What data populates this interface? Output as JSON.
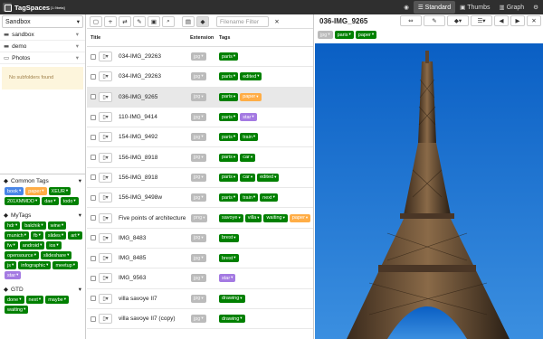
{
  "app": {
    "title": "TagSpaces",
    "version": "[1.9beta]"
  },
  "topbar": {
    "standard": "Standard",
    "thumbs": "Thumbs",
    "graph": "Graph"
  },
  "location": "Sandbox",
  "folders": [
    "sandbox",
    "demo",
    "Photos"
  ],
  "no_subfolders": "No subfolders found",
  "tag_groups": [
    {
      "name": "Common Tags",
      "tags": [
        {
          "label": "book",
          "color": "blue"
        },
        {
          "label": "paper",
          "color": "orange"
        },
        {
          "label": "XEUR",
          "color": "green"
        },
        {
          "label": "201XMMDD",
          "color": "green"
        },
        {
          "label": "dae",
          "color": "green"
        },
        {
          "label": "todo",
          "color": "green"
        }
      ]
    },
    {
      "name": "MyTags",
      "tags": [
        {
          "label": "hdr",
          "color": "green"
        },
        {
          "label": "balchik",
          "color": "green"
        },
        {
          "label": "wine",
          "color": "green"
        },
        {
          "label": "munich",
          "color": "green"
        },
        {
          "label": "fb",
          "color": "green"
        },
        {
          "label": "slides",
          "color": "green"
        },
        {
          "label": "art",
          "color": "green"
        },
        {
          "label": "fw",
          "color": "green"
        },
        {
          "label": "android",
          "color": "green"
        },
        {
          "label": "ios",
          "color": "green"
        },
        {
          "label": "opensource",
          "color": "green"
        },
        {
          "label": "slideshare",
          "color": "green"
        },
        {
          "label": "js",
          "color": "green"
        },
        {
          "label": "infographic",
          "color": "green"
        },
        {
          "label": "meetup",
          "color": "green"
        },
        {
          "label": "star",
          "color": "purple"
        }
      ]
    },
    {
      "name": "GTD",
      "tags": [
        {
          "label": "done",
          "color": "green"
        },
        {
          "label": "next",
          "color": "green"
        },
        {
          "label": "maybe",
          "color": "green"
        },
        {
          "label": "waiting",
          "color": "green"
        }
      ]
    }
  ],
  "filter_placeholder": "Filename Filter",
  "columns": {
    "title": "Title",
    "extension": "Extension",
    "tags": "Tags"
  },
  "files": [
    {
      "name": "034-IMG_29263",
      "ext": "jpg",
      "tags": [
        {
          "label": "paris",
          "color": "green"
        }
      ]
    },
    {
      "name": "034-IMG_29263",
      "ext": "jpg",
      "tags": [
        {
          "label": "paris",
          "color": "green"
        },
        {
          "label": "edited",
          "color": "green"
        }
      ]
    },
    {
      "name": "036-IMG_9265",
      "ext": "jpg",
      "tags": [
        {
          "label": "paris",
          "color": "green"
        },
        {
          "label": "paper",
          "color": "orange"
        }
      ],
      "selected": true
    },
    {
      "name": "110-IMG_9414",
      "ext": "jpg",
      "tags": [
        {
          "label": "paris",
          "color": "green"
        },
        {
          "label": "star",
          "color": "purple"
        }
      ]
    },
    {
      "name": "154-IMG_9492",
      "ext": "jpg",
      "tags": [
        {
          "label": "paris",
          "color": "green"
        },
        {
          "label": "train",
          "color": "green"
        }
      ]
    },
    {
      "name": "156-IMG_8918",
      "ext": "jpg",
      "tags": [
        {
          "label": "paris",
          "color": "green"
        },
        {
          "label": "car",
          "color": "green"
        }
      ]
    },
    {
      "name": "156-IMG_8918",
      "ext": "jpg",
      "tags": [
        {
          "label": "paris",
          "color": "green"
        },
        {
          "label": "car",
          "color": "green"
        },
        {
          "label": "edited",
          "color": "green"
        }
      ]
    },
    {
      "name": "156-IMG_9498w",
      "ext": "jpg",
      "tags": [
        {
          "label": "paris",
          "color": "green"
        },
        {
          "label": "train",
          "color": "green"
        },
        {
          "label": "next",
          "color": "green"
        }
      ]
    },
    {
      "name": "Five points of architecture",
      "ext": "png",
      "tags": [
        {
          "label": "savoye",
          "color": "green"
        },
        {
          "label": "villa",
          "color": "green"
        },
        {
          "label": "waiting",
          "color": "green"
        },
        {
          "label": "paper",
          "color": "orange"
        }
      ]
    },
    {
      "name": "IMG_8483",
      "ext": "jpg",
      "tags": [
        {
          "label": "brest",
          "color": "green"
        }
      ]
    },
    {
      "name": "IMG_8485",
      "ext": "jpg",
      "tags": [
        {
          "label": "brest",
          "color": "green"
        }
      ]
    },
    {
      "name": "IMG_9563",
      "ext": "jpg",
      "tags": [
        {
          "label": "star",
          "color": "purple"
        }
      ]
    },
    {
      "name": "villa savoye II7",
      "ext": "jpg",
      "tags": [
        {
          "label": "drawing",
          "color": "green"
        }
      ]
    },
    {
      "name": "villa savoye II7 (copy)",
      "ext": "jpg",
      "tags": [
        {
          "label": "drawing",
          "color": "green"
        }
      ]
    }
  ],
  "preview": {
    "title": "036-IMG_9265",
    "ext": "jpg",
    "tags": [
      {
        "label": "paris",
        "color": "green"
      },
      {
        "label": "paper",
        "color": "green"
      }
    ]
  }
}
